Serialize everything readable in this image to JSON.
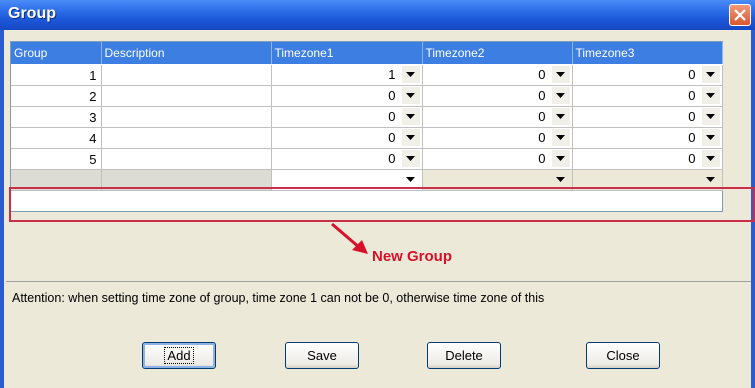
{
  "window": {
    "title": "Group"
  },
  "grid": {
    "columns": [
      "Group",
      "Description",
      "Timezone1",
      "Timezone2",
      "Timezone3"
    ],
    "rows": [
      {
        "group": "1",
        "description": "",
        "tz1": "1",
        "tz2": "0",
        "tz3": "0"
      },
      {
        "group": "2",
        "description": "",
        "tz1": "0",
        "tz2": "0",
        "tz3": "0"
      },
      {
        "group": "3",
        "description": "",
        "tz1": "0",
        "tz2": "0",
        "tz3": "0"
      },
      {
        "group": "4",
        "description": "",
        "tz1": "0",
        "tz2": "0",
        "tz3": "0"
      },
      {
        "group": "5",
        "description": "",
        "tz1": "0",
        "tz2": "0",
        "tz3": "0"
      }
    ]
  },
  "annotation": {
    "label": "New Group",
    "color": "#d8102a"
  },
  "attention": "Attention: when setting time zone of group, time zone 1 can not be 0, otherwise time zone of this",
  "buttons": {
    "add": "Add",
    "save": "Save",
    "delete": "Delete",
    "close": "Close"
  },
  "colors": {
    "title_bar": "#2a6ae6",
    "header": "#3c7ee2",
    "face": "#ece9d8"
  }
}
